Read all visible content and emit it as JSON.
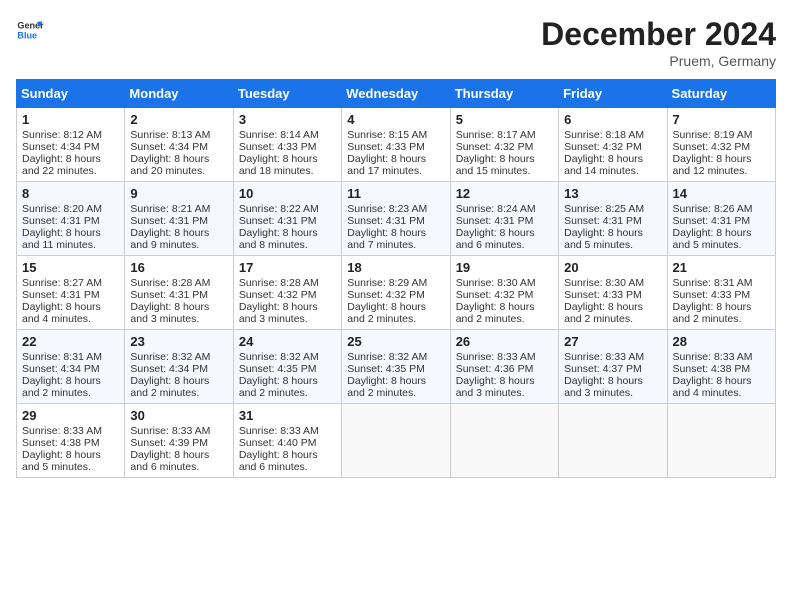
{
  "logo": {
    "line1": "General",
    "line2": "Blue"
  },
  "title": "December 2024",
  "subtitle": "Pruem, Germany",
  "days_of_week": [
    "Sunday",
    "Monday",
    "Tuesday",
    "Wednesday",
    "Thursday",
    "Friday",
    "Saturday"
  ],
  "weeks": [
    [
      {
        "day": "1",
        "sunrise": "8:12 AM",
        "sunset": "4:34 PM",
        "daylight": "8 hours and 22 minutes."
      },
      {
        "day": "2",
        "sunrise": "8:13 AM",
        "sunset": "4:34 PM",
        "daylight": "8 hours and 20 minutes."
      },
      {
        "day": "3",
        "sunrise": "8:14 AM",
        "sunset": "4:33 PM",
        "daylight": "8 hours and 18 minutes."
      },
      {
        "day": "4",
        "sunrise": "8:15 AM",
        "sunset": "4:33 PM",
        "daylight": "8 hours and 17 minutes."
      },
      {
        "day": "5",
        "sunrise": "8:17 AM",
        "sunset": "4:32 PM",
        "daylight": "8 hours and 15 minutes."
      },
      {
        "day": "6",
        "sunrise": "8:18 AM",
        "sunset": "4:32 PM",
        "daylight": "8 hours and 14 minutes."
      },
      {
        "day": "7",
        "sunrise": "8:19 AM",
        "sunset": "4:32 PM",
        "daylight": "8 hours and 12 minutes."
      }
    ],
    [
      {
        "day": "8",
        "sunrise": "8:20 AM",
        "sunset": "4:31 PM",
        "daylight": "8 hours and 11 minutes."
      },
      {
        "day": "9",
        "sunrise": "8:21 AM",
        "sunset": "4:31 PM",
        "daylight": "8 hours and 9 minutes."
      },
      {
        "day": "10",
        "sunrise": "8:22 AM",
        "sunset": "4:31 PM",
        "daylight": "8 hours and 8 minutes."
      },
      {
        "day": "11",
        "sunrise": "8:23 AM",
        "sunset": "4:31 PM",
        "daylight": "8 hours and 7 minutes."
      },
      {
        "day": "12",
        "sunrise": "8:24 AM",
        "sunset": "4:31 PM",
        "daylight": "8 hours and 6 minutes."
      },
      {
        "day": "13",
        "sunrise": "8:25 AM",
        "sunset": "4:31 PM",
        "daylight": "8 hours and 5 minutes."
      },
      {
        "day": "14",
        "sunrise": "8:26 AM",
        "sunset": "4:31 PM",
        "daylight": "8 hours and 5 minutes."
      }
    ],
    [
      {
        "day": "15",
        "sunrise": "8:27 AM",
        "sunset": "4:31 PM",
        "daylight": "8 hours and 4 minutes."
      },
      {
        "day": "16",
        "sunrise": "8:28 AM",
        "sunset": "4:31 PM",
        "daylight": "8 hours and 3 minutes."
      },
      {
        "day": "17",
        "sunrise": "8:28 AM",
        "sunset": "4:32 PM",
        "daylight": "8 hours and 3 minutes."
      },
      {
        "day": "18",
        "sunrise": "8:29 AM",
        "sunset": "4:32 PM",
        "daylight": "8 hours and 2 minutes."
      },
      {
        "day": "19",
        "sunrise": "8:30 AM",
        "sunset": "4:32 PM",
        "daylight": "8 hours and 2 minutes."
      },
      {
        "day": "20",
        "sunrise": "8:30 AM",
        "sunset": "4:33 PM",
        "daylight": "8 hours and 2 minutes."
      },
      {
        "day": "21",
        "sunrise": "8:31 AM",
        "sunset": "4:33 PM",
        "daylight": "8 hours and 2 minutes."
      }
    ],
    [
      {
        "day": "22",
        "sunrise": "8:31 AM",
        "sunset": "4:34 PM",
        "daylight": "8 hours and 2 minutes."
      },
      {
        "day": "23",
        "sunrise": "8:32 AM",
        "sunset": "4:34 PM",
        "daylight": "8 hours and 2 minutes."
      },
      {
        "day": "24",
        "sunrise": "8:32 AM",
        "sunset": "4:35 PM",
        "daylight": "8 hours and 2 minutes."
      },
      {
        "day": "25",
        "sunrise": "8:32 AM",
        "sunset": "4:35 PM",
        "daylight": "8 hours and 2 minutes."
      },
      {
        "day": "26",
        "sunrise": "8:33 AM",
        "sunset": "4:36 PM",
        "daylight": "8 hours and 3 minutes."
      },
      {
        "day": "27",
        "sunrise": "8:33 AM",
        "sunset": "4:37 PM",
        "daylight": "8 hours and 3 minutes."
      },
      {
        "day": "28",
        "sunrise": "8:33 AM",
        "sunset": "4:38 PM",
        "daylight": "8 hours and 4 minutes."
      }
    ],
    [
      {
        "day": "29",
        "sunrise": "8:33 AM",
        "sunset": "4:38 PM",
        "daylight": "8 hours and 5 minutes."
      },
      {
        "day": "30",
        "sunrise": "8:33 AM",
        "sunset": "4:39 PM",
        "daylight": "8 hours and 6 minutes."
      },
      {
        "day": "31",
        "sunrise": "8:33 AM",
        "sunset": "4:40 PM",
        "daylight": "8 hours and 6 minutes."
      },
      null,
      null,
      null,
      null
    ]
  ]
}
